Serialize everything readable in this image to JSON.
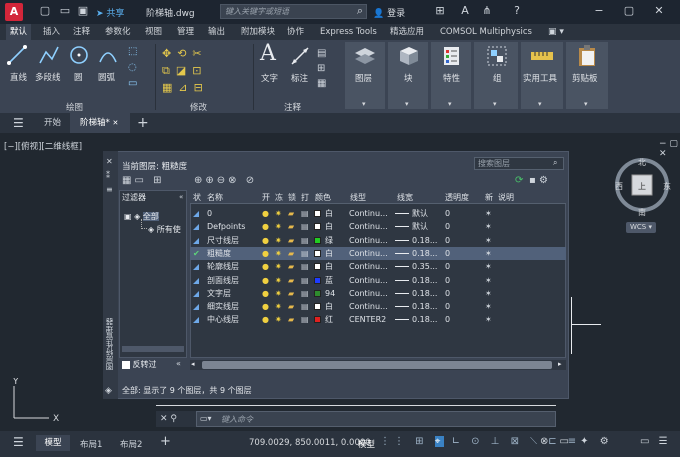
{
  "app": {
    "logo": "A",
    "share": "共享",
    "filename": "阶梯轴.dwg",
    "search_placeholder": "键入关键字或短语",
    "login": "登录"
  },
  "ribbon_tabs": [
    "默认",
    "插入",
    "注释",
    "参数化",
    "视图",
    "管理",
    "输出",
    "附加模块",
    "协作",
    "Express Tools",
    "精选应用",
    "COMSOL Multiphysics"
  ],
  "ribbon": {
    "draw_tools": [
      "直线",
      "多段线",
      "圆",
      "圆弧"
    ],
    "draw_panel": "绘图",
    "modify_panel": "修改",
    "text": "文字",
    "dimension": "标注",
    "annotate_panel": "注释",
    "layers": "图层",
    "block": "块",
    "properties": "特性",
    "group": "组",
    "utilities": "实用工具",
    "clipboard": "剪贴板"
  },
  "doc_tabs": {
    "start": "开始",
    "active": "阶梯轴*"
  },
  "viewport_label": "[−][俯视][二维线框]",
  "viewcube": {
    "north": "北",
    "south": "南",
    "east": "东",
    "west": "西",
    "top": "上",
    "wcs": "WCS"
  },
  "palette": {
    "current_layer": "当前图层: 粗糙度",
    "search_placeholder": "搜索图层",
    "filter_label": "过滤器",
    "tree_all": "全部",
    "tree_used": "所有使",
    "invert": "反转过",
    "side_title": "图层特性管理器",
    "footer": "全部: 显示了 9 个图层，共 9 个图层",
    "headers": [
      "状",
      "名称",
      "开",
      "冻",
      "锁",
      "打",
      "颜色",
      "线型",
      "线宽",
      "透明度",
      "新",
      "说明"
    ],
    "rows": [
      {
        "name": "0",
        "color_name": "白",
        "color": "#ffffff",
        "linetype": "Continu...",
        "lineweight": "默认",
        "transparency": "0",
        "selected": false
      },
      {
        "name": "Defpoints",
        "color_name": "白",
        "color": "#ffffff",
        "linetype": "Continu...",
        "lineweight": "默认",
        "transparency": "0",
        "selected": false
      },
      {
        "name": "尺寸线层",
        "color_name": "绿",
        "color": "#22cc22",
        "linetype": "Continu...",
        "lineweight": "0.18...",
        "transparency": "0",
        "selected": false
      },
      {
        "name": "粗糙度",
        "color_name": "白",
        "color": "#ffffff",
        "linetype": "Continu...",
        "lineweight": "0.18...",
        "transparency": "0",
        "selected": true
      },
      {
        "name": "轮廓线层",
        "color_name": "白",
        "color": "#ffffff",
        "linetype": "Continu...",
        "lineweight": "0.35...",
        "transparency": "0",
        "selected": false
      },
      {
        "name": "剖面线层",
        "color_name": "蓝",
        "color": "#1e3cff",
        "linetype": "Continu...",
        "lineweight": "0.18...",
        "transparency": "0",
        "selected": false
      },
      {
        "name": "文字层",
        "color_name": "94",
        "color": "#2e8b2e",
        "linetype": "Continu...",
        "lineweight": "0.18...",
        "transparency": "0",
        "selected": false
      },
      {
        "name": "细实线层",
        "color_name": "白",
        "color": "#ffffff",
        "linetype": "Continu...",
        "lineweight": "0.18...",
        "transparency": "0",
        "selected": false
      },
      {
        "name": "中心线层",
        "color_name": "红",
        "color": "#e02020",
        "linetype": "CENTER2",
        "lineweight": "0.18...",
        "transparency": "0",
        "selected": false
      }
    ]
  },
  "command_placeholder": "键入命令",
  "status": {
    "tabs": [
      "模型",
      "布局1",
      "布局2"
    ],
    "coords": "709.0029, 850.0011, 0.0000",
    "mode": "模型"
  }
}
